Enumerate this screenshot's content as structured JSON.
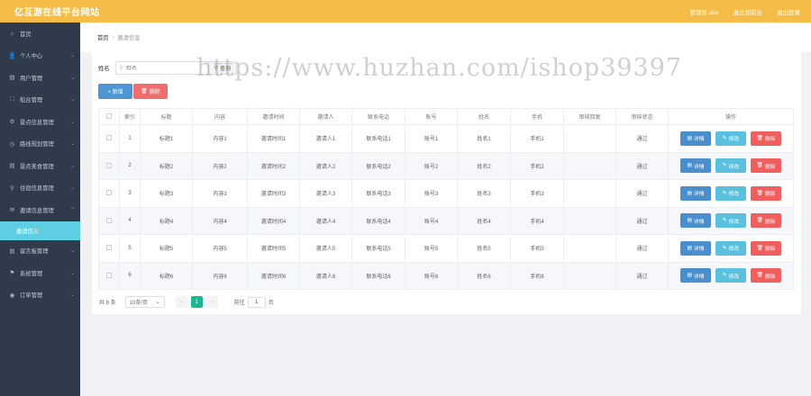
{
  "header": {
    "brand": "亿互游在线平台网站",
    "links": [
      "管理员 abo",
      "退出到前台",
      "退出登录"
    ]
  },
  "sidebar": {
    "items": [
      {
        "icon": "home-icon",
        "glyph": "⌂",
        "label": "首页",
        "chevron": ""
      },
      {
        "icon": "user-icon",
        "glyph": "👤",
        "label": "个人中心",
        "chevron": "⌄"
      },
      {
        "icon": "users-icon",
        "glyph": "▤",
        "label": "用户管理",
        "chevron": "⌄"
      },
      {
        "icon": "dashboard-icon",
        "glyph": "⛶",
        "label": "船台管理",
        "chevron": "⌄"
      },
      {
        "icon": "tag-icon",
        "glyph": "⚙",
        "label": "景点信息管理",
        "chevron": "⌄"
      },
      {
        "icon": "route-icon",
        "glyph": "◷",
        "label": "路线规划管理",
        "chevron": "⌄"
      },
      {
        "icon": "scenic-icon",
        "glyph": "▤",
        "label": "景点美食管理",
        "chevron": "⌄"
      },
      {
        "icon": "location-icon",
        "glyph": "⚲",
        "label": "住宿信息管理",
        "chevron": "⌄"
      },
      {
        "icon": "mail-icon",
        "glyph": "✉",
        "label": "邀请信息管理",
        "chevron": "⌃"
      }
    ],
    "active_sub": "邀请信息",
    "items_after": [
      {
        "icon": "message-icon",
        "glyph": "▤",
        "label": "留言板管理",
        "chevron": "⌄"
      },
      {
        "icon": "flag-icon",
        "glyph": "⚑",
        "label": "系统管理",
        "chevron": "⌄"
      },
      {
        "icon": "order-icon",
        "glyph": "◉",
        "label": "订单管理",
        "chevron": "⌄"
      }
    ]
  },
  "breadcrumb": {
    "home": "首页",
    "sep": "/",
    "current": "邀请信息"
  },
  "search": {
    "label": "姓名",
    "placeholder": "姓名",
    "button": "查询"
  },
  "actions": {
    "add": "+ 新增",
    "delete": "删除"
  },
  "table": {
    "headers": [
      "",
      "索引",
      "标题",
      "内容",
      "邀请时间",
      "邀请人",
      "联系电话",
      "账号",
      "姓名",
      "手机",
      "审核回复",
      "审核状态",
      "操作"
    ],
    "rows": [
      [
        "1",
        "标题1",
        "内容1",
        "邀请时间1",
        "邀请人1",
        "联系电话1",
        "账号1",
        "姓名1",
        "手机1",
        "",
        "通过"
      ],
      [
        "2",
        "标题2",
        "内容2",
        "邀请时间2",
        "邀请人2",
        "联系电话2",
        "账号2",
        "姓名2",
        "手机2",
        "",
        "通过"
      ],
      [
        "3",
        "标题3",
        "内容3",
        "邀请时间3",
        "邀请人3",
        "联系电话3",
        "账号3",
        "姓名3",
        "手机3",
        "",
        "通过"
      ],
      [
        "4",
        "标题4",
        "内容4",
        "邀请时间4",
        "邀请人4",
        "联系电话4",
        "账号4",
        "姓名4",
        "手机4",
        "",
        "通过"
      ],
      [
        "5",
        "标题5",
        "内容5",
        "邀请时间5",
        "邀请人5",
        "联系电话5",
        "账号5",
        "姓名5",
        "手机5",
        "",
        "通过"
      ],
      [
        "6",
        "标题6",
        "内容6",
        "邀请时间6",
        "邀请人6",
        "联系电话6",
        "账号6",
        "姓名6",
        "手机6",
        "",
        "通过"
      ]
    ],
    "op_labels": {
      "detail": "详情",
      "edit": "修改",
      "delete": "删除"
    }
  },
  "pagination": {
    "total": "共 6 条",
    "page_size": "10条/页",
    "prev": "‹",
    "next": "›",
    "current_page": "1",
    "goto_prefix": "前往",
    "goto_value": "1",
    "goto_suffix": "页"
  },
  "watermark": "https://www.huzhan.com/ishop39397",
  "colors": {
    "header": "#f5bd47",
    "sidebar": "#2f3a4b",
    "active_sub": "#5ecfe3",
    "primary": "#4f95d2",
    "danger": "#f06d6d",
    "info": "#5bc0de",
    "page_active": "#1cb990"
  }
}
